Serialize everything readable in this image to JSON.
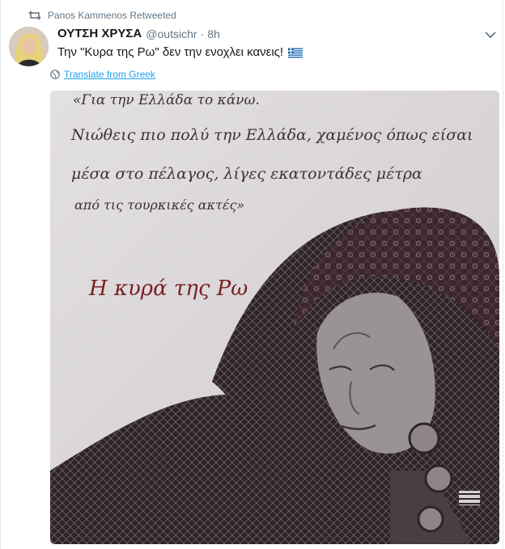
{
  "retweet": {
    "label": "Panos Kammenos Retweeted"
  },
  "author": {
    "name": "ΟΥΤΣΗ ΧΡΥΣΑ",
    "handle": "@outsichr",
    "time": "8h"
  },
  "tweet": {
    "text": "Την \"Κυρα της Ρω\" δεν την ενοχλει κανεις!",
    "flag_icon": "greek-flag-icon"
  },
  "translate": {
    "label": "Translate from Greek"
  },
  "media": {
    "poem_lines": [
      "«Για την Ελλάδα το κάνω.",
      "Νιώθεις πιο πολύ την Ελλάδα, χαμένος όπως είσαι",
      "μέσα στο πέλαγος, λίγες εκατοντάδες μέτρα",
      "από τις τουρκικές ακτές»"
    ],
    "signature": "Η κυρά της Ρω",
    "colors": {
      "background": "#d9d6d8",
      "ink": "#3b3336",
      "signature": "#7a1f24",
      "scarf": "#3c2630"
    }
  },
  "colors": {
    "accent": "#1da1f2",
    "muted": "#657786",
    "text": "#14171a"
  }
}
